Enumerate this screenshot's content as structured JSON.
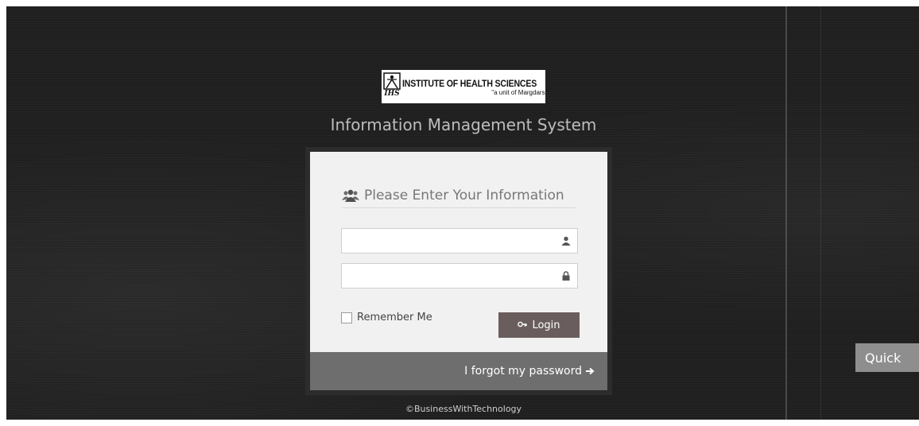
{
  "logo": {
    "title": "INSTITUTE OF HEALTH SCIENCES",
    "subtitle": "\"a unit of Margdarsi\"",
    "abbr": "IHS"
  },
  "app_title": "Information Management System",
  "login": {
    "heading": "Please Enter Your Information",
    "heading_icon": "users-icon",
    "username": {
      "value": "",
      "icon": "user-icon"
    },
    "password": {
      "value": "",
      "icon": "lock-icon"
    },
    "remember_label": "Remember Me",
    "remember_checked": false,
    "login_button": "Login",
    "login_icon": "key-icon",
    "forgot_link": "I forgot my password",
    "forgot_icon": "arrow-right-icon"
  },
  "copyright": "©BusinessWithTechnology",
  "quick_button": "Quick",
  "colors": {
    "background": "#1f1f1f",
    "box": "#f1f1f1",
    "login_button": "#6a5d5d",
    "box_footer": "#6e6e6e",
    "title_text": "#bdbdbd"
  }
}
